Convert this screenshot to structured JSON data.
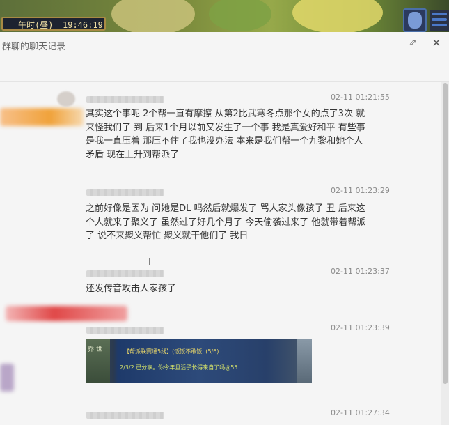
{
  "game_bar": {
    "period": "午时(昼)",
    "clock": "19:46:19"
  },
  "window": {
    "title": "群聊的聊天记录",
    "pin_icon": "pin-icon",
    "close_icon": "close-icon",
    "close_glyph": "✕",
    "pin_glyph": "⇗"
  },
  "messages": [
    {
      "time": "02-11 01:21:55",
      "text": "其实这个事呢 2个帮一直有摩擦 从第2比武寒冬点那个女的点了3次 就来怪我们了 到 后来1个月以前又发生了一个事 我是真爱好和平  有些事 是我一直压着 那压不住了我也没办法 本来是我们帮一个九黎和她个人矛盾 现在上升到帮派了"
    },
    {
      "time": "02-11 01:23:29",
      "text": "之前好像是因为 问她是DL 吗然后就爆发了 骂人家头像孩子  丑 后来这个人就来了聚义了  虽然过了好几个月了  今天偷袭过来了 他就带着帮派了 说不来聚义帮忙 聚义就干他们了 我日"
    },
    {
      "time": "02-11 01:23:37",
      "text": "还发传音攻击人家孩子"
    },
    {
      "time": "02-11 01:23:39",
      "image_line1": "【帮派联赛通5线】(饭饭不敢饭,  (5/6)",
      "image_line2": "2/3/2 已分享。你今年且活子长得来自了吗@55",
      "image_side": "乔  世"
    },
    {
      "time": "02-11 01:27:34"
    }
  ],
  "colors": {
    "highlight_orange": "#f0a23a",
    "blur_red": "#e04848"
  }
}
